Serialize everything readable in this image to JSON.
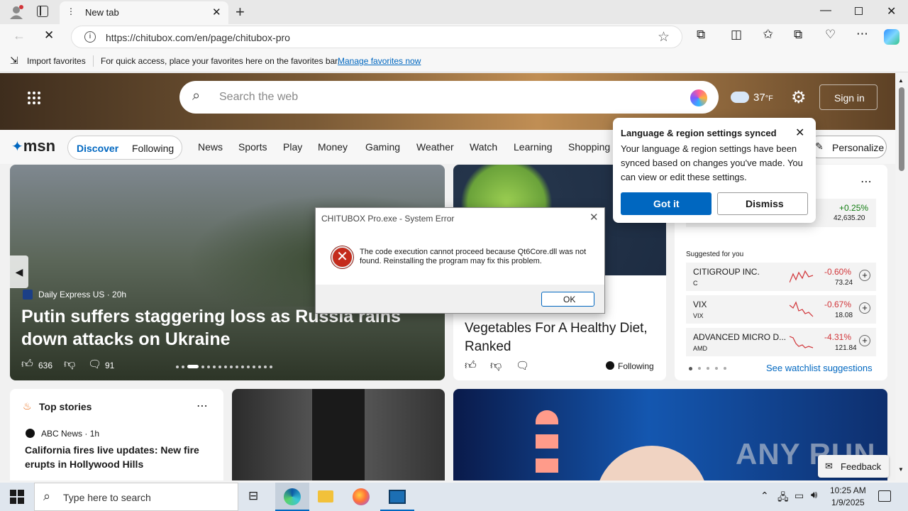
{
  "browser": {
    "tab_title": "New tab",
    "url": "https://chitubox.com/en/page/chitubox-pro",
    "import_favorites": "Import favorites",
    "favorites_hint": "For quick access, place your favorites here on the favorites bar.",
    "manage_favorites": "Manage favorites now"
  },
  "msn": {
    "search_placeholder": "Search the web",
    "weather_temp": "37",
    "weather_unit": "°F",
    "sign_in": "Sign in",
    "logo": "msn",
    "tabs": [
      "Discover",
      "Following"
    ],
    "nav": [
      "News",
      "Sports",
      "Play",
      "Money",
      "Gaming",
      "Weather",
      "Watch",
      "Learning",
      "Shopping"
    ],
    "personalize": "Personalize"
  },
  "hero_story": {
    "source": "Daily Express US",
    "age": "20h",
    "headline": "Putin suffers staggering loss as Russia rains down attacks on Ukraine",
    "likes": "636",
    "comments": "91"
  },
  "second_story": {
    "headline": "Vegetables For A Healthy Diet, Ranked",
    "following": "Following"
  },
  "watchlist": {
    "top_change": "+0.25%",
    "top_value": "42,635.20",
    "suggested_label": "Suggested for you",
    "stocks": [
      {
        "name": "CITIGROUP INC.",
        "ticker": "C",
        "change": "-0.60%",
        "price": "73.24"
      },
      {
        "name": "VIX",
        "ticker": "VIX",
        "change": "-0.67%",
        "price": "18.08"
      },
      {
        "name": "ADVANCED MICRO D...",
        "ticker": "AMD",
        "change": "-4.31%",
        "price": "121.84"
      }
    ],
    "see_more": "See watchlist suggestions"
  },
  "top_stories": {
    "title": "Top stories",
    "source": "ABC News",
    "age": "1h",
    "headline": "California fires live updates: New fire erupts in Hollywood Hills"
  },
  "feedback": "Feedback",
  "watermark": "ANY RUN",
  "language_popup": {
    "title": "Language & region settings synced",
    "body": "Your language & region settings have been synced based on changes you've made. You can view or edit these settings.",
    "got_it": "Got it",
    "dismiss": "Dismiss"
  },
  "dialog": {
    "title": "CHITUBOX Pro.exe - System Error",
    "message": "The code execution cannot proceed because Qt6Core.dll was not found. Reinstalling the program may fix this problem.",
    "ok": "OK"
  },
  "taskbar": {
    "search_placeholder": "Type here to search",
    "time": "10:25 AM",
    "date": "1/9/2025"
  },
  "colors": {
    "accent_blue": "#0067c0",
    "loss_red": "#d13438",
    "gain_green": "#107c10",
    "error_red": "#c42b1c"
  }
}
